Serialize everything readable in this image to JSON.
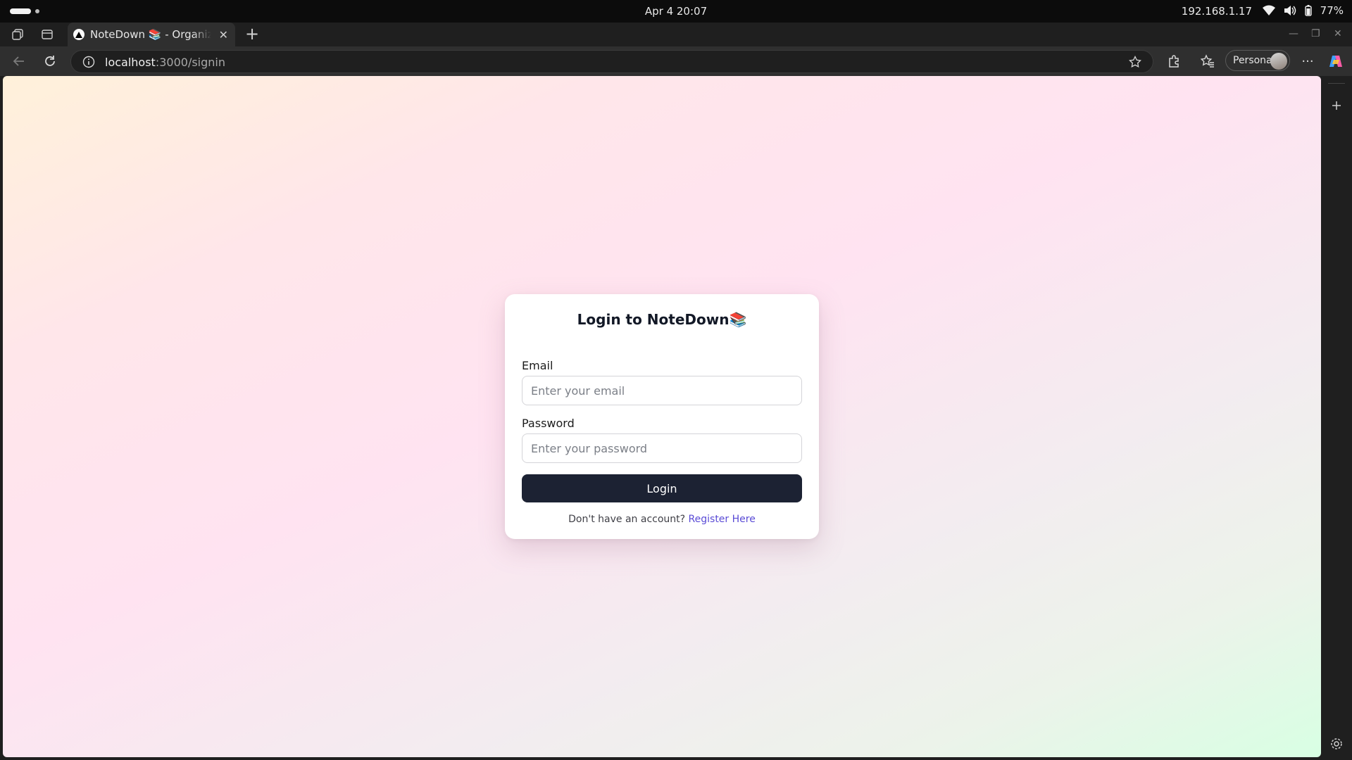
{
  "os": {
    "datetime": "Apr 4  20:07",
    "ip": "192.168.1.17",
    "battery": "77%"
  },
  "browser": {
    "tab_title": "NoteDown 📚 - Organize Your Notes",
    "url_host": "localhost",
    "url_path": ":3000/signin",
    "profile_label": "Personal"
  },
  "login": {
    "title": "Login to NoteDown📚",
    "email_label": "Email",
    "email_placeholder": "Enter your email",
    "password_label": "Password",
    "password_placeholder": "Enter your password",
    "submit_label": "Login",
    "footer_text": "Don't have an account?",
    "register_link": "Register Here"
  },
  "colors": {
    "button_bg": "#1c2233",
    "link": "#5a4bd6"
  }
}
